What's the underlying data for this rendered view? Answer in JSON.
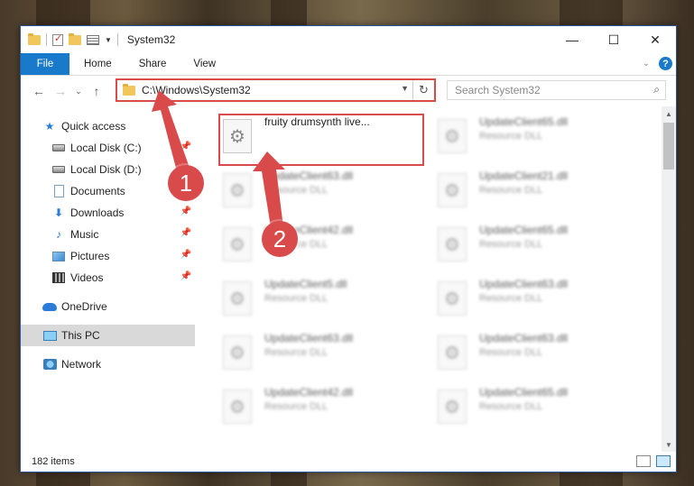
{
  "window": {
    "title": "System32",
    "controls": {
      "minimize": "—",
      "maximize": "☐",
      "close": "✕"
    }
  },
  "ribbon": {
    "file_tab": "File",
    "tabs": [
      "Home",
      "Share",
      "View"
    ],
    "help": "?"
  },
  "navbar": {
    "address": "C:\\Windows\\System32",
    "search_placeholder": "Search System32"
  },
  "sidebar": {
    "items": [
      {
        "label": "Quick access",
        "icon": "star-icon"
      },
      {
        "label": "Local Disk (C:)",
        "icon": "drive-icon",
        "pinned": true
      },
      {
        "label": "Local Disk (D:)",
        "icon": "drive-icon"
      },
      {
        "label": "Documents",
        "icon": "documents-icon",
        "pinned": true
      },
      {
        "label": "Downloads",
        "icon": "download-icon",
        "pinned": true
      },
      {
        "label": "Music",
        "icon": "music-icon",
        "pinned": true
      },
      {
        "label": "Pictures",
        "icon": "pictures-icon",
        "pinned": true
      },
      {
        "label": "Videos",
        "icon": "videos-icon",
        "pinned": true
      },
      {
        "label": "OneDrive",
        "icon": "cloud-icon"
      },
      {
        "label": "This PC",
        "icon": "computer-icon"
      },
      {
        "label": "Network",
        "icon": "network-icon"
      }
    ]
  },
  "files": [
    {
      "name": "fruity drumsynth live...",
      "type": ""
    },
    {
      "name": "UpdateClient65.dll",
      "type": "Resource DLL"
    },
    {
      "name": "UpdateClient63.dll",
      "type": "Resource DLL"
    },
    {
      "name": "UpdateClient21.dll",
      "type": "Resource DLL"
    },
    {
      "name": "UpdateClient42.dll",
      "type": "Resource DLL"
    },
    {
      "name": "UpdateClient65.dll",
      "type": "Resource DLL"
    },
    {
      "name": "UpdateClient5.dll",
      "type": "Resource DLL"
    },
    {
      "name": "UpdateClient63.dll",
      "type": "Resource DLL"
    },
    {
      "name": "UpdateClient63.dll",
      "type": "Resource DLL"
    },
    {
      "name": "UpdateClient63.dll",
      "type": "Resource DLL"
    },
    {
      "name": "UpdateClient42.dll",
      "type": "Resource DLL"
    },
    {
      "name": "UpdateClient65.dll",
      "type": "Resource DLL"
    }
  ],
  "status": {
    "count": "182 items"
  },
  "callouts": {
    "one": "1",
    "two": "2"
  },
  "colors": {
    "accent": "#1979ca",
    "highlight": "#d94b4b",
    "selected": "#cce8ff"
  }
}
